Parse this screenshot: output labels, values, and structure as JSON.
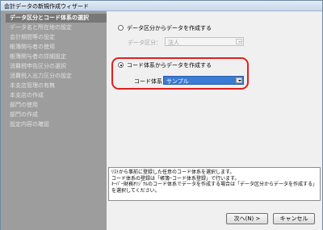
{
  "window": {
    "title": "会計データの新規作成ウィザード"
  },
  "sidebar": {
    "items": [
      {
        "label": "データ区分とコード体系の選択",
        "active": true
      },
      {
        "label": "データ名と所在地の設定"
      },
      {
        "label": "会計期間等の設定"
      },
      {
        "label": "帳簿関与者の使用"
      },
      {
        "label": "帳簿関与者の詳細設定"
      },
      {
        "label": "消費税申告区分の選択"
      },
      {
        "label": "消費税入出力区分の設定"
      },
      {
        "label": "本支店管理の有無"
      },
      {
        "label": "本支店の作成"
      },
      {
        "label": "部門の使用"
      },
      {
        "label": "部門の作成"
      },
      {
        "label": "設定内容の確認"
      }
    ]
  },
  "main": {
    "option1": {
      "label": "データ区分からデータを作成する",
      "checked": false
    },
    "data_category": {
      "label": "データ区分：",
      "value": "法人"
    },
    "option2": {
      "label": "コード体系からデータを作成する",
      "checked": true
    },
    "code_system": {
      "label": "コード体系：",
      "value": "サンプル"
    },
    "description": [
      "ﾘｽﾄから事前に登録した任意のコード体系を選択します。",
      "コード体系の登録は「帳簿ｰコード体系登録」で行います。",
      "ｷｰﾊﾟｰ財務ｵﾘｼﾞﾅﾙのコード体系でデータを作成する場合は「データ区分からデータを作成する」",
      "を選択してください。"
    ]
  },
  "buttons": {
    "next": "次へ(N) >",
    "cancel": "キャンセル"
  },
  "colors": {
    "highlight": "#e02020",
    "sidebar_bg": "#9d9d9d",
    "sidebar_active": "#787878",
    "select_focus": "#3a7bd5"
  }
}
